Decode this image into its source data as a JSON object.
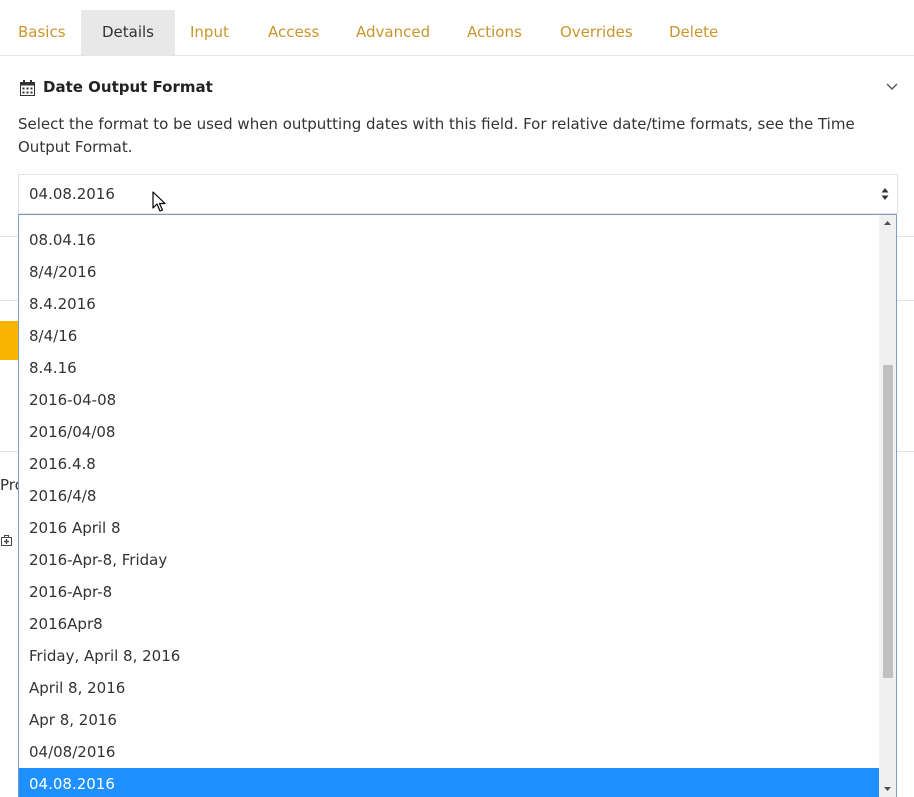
{
  "tabs": [
    {
      "label": "Basics",
      "active": false
    },
    {
      "label": "Details",
      "active": true
    },
    {
      "label": "Input",
      "active": false
    },
    {
      "label": "Access",
      "active": false
    },
    {
      "label": "Advanced",
      "active": false
    },
    {
      "label": "Actions",
      "active": false
    },
    {
      "label": "Overrides",
      "active": false
    },
    {
      "label": "Delete",
      "active": false
    }
  ],
  "section": {
    "icon": "calendar-icon",
    "title": "Date Output Format",
    "collapse_icon": "chevron-down-icon",
    "description": "Select the format to be used when outputting dates with this field. For relative date/time formats, see the Time Output Format."
  },
  "select": {
    "value": "04.08.2016",
    "options": [
      "08.04.16",
      "8/4/2016",
      "8.4.2016",
      "8/4/16",
      "8.4.16",
      "2016-04-08",
      "2016/04/08",
      "2016.4.8",
      "2016/4/8",
      "2016 April 8",
      "2016-Apr-8, Friday",
      "2016-Apr-8",
      "2016Apr8",
      "Friday, April 8, 2016",
      "April 8, 2016",
      "Apr 8, 2016",
      "04/08/2016",
      "04.08.2016"
    ],
    "selected_index": 17
  },
  "background": {
    "partial_text": "Pro"
  },
  "colors": {
    "tab_link": "#c9962c",
    "tab_active_bg": "#e8e8e8",
    "selected_option": "#1e90ff",
    "dropdown_border": "#7a9cc6",
    "accent_orange": "#f8b400"
  }
}
